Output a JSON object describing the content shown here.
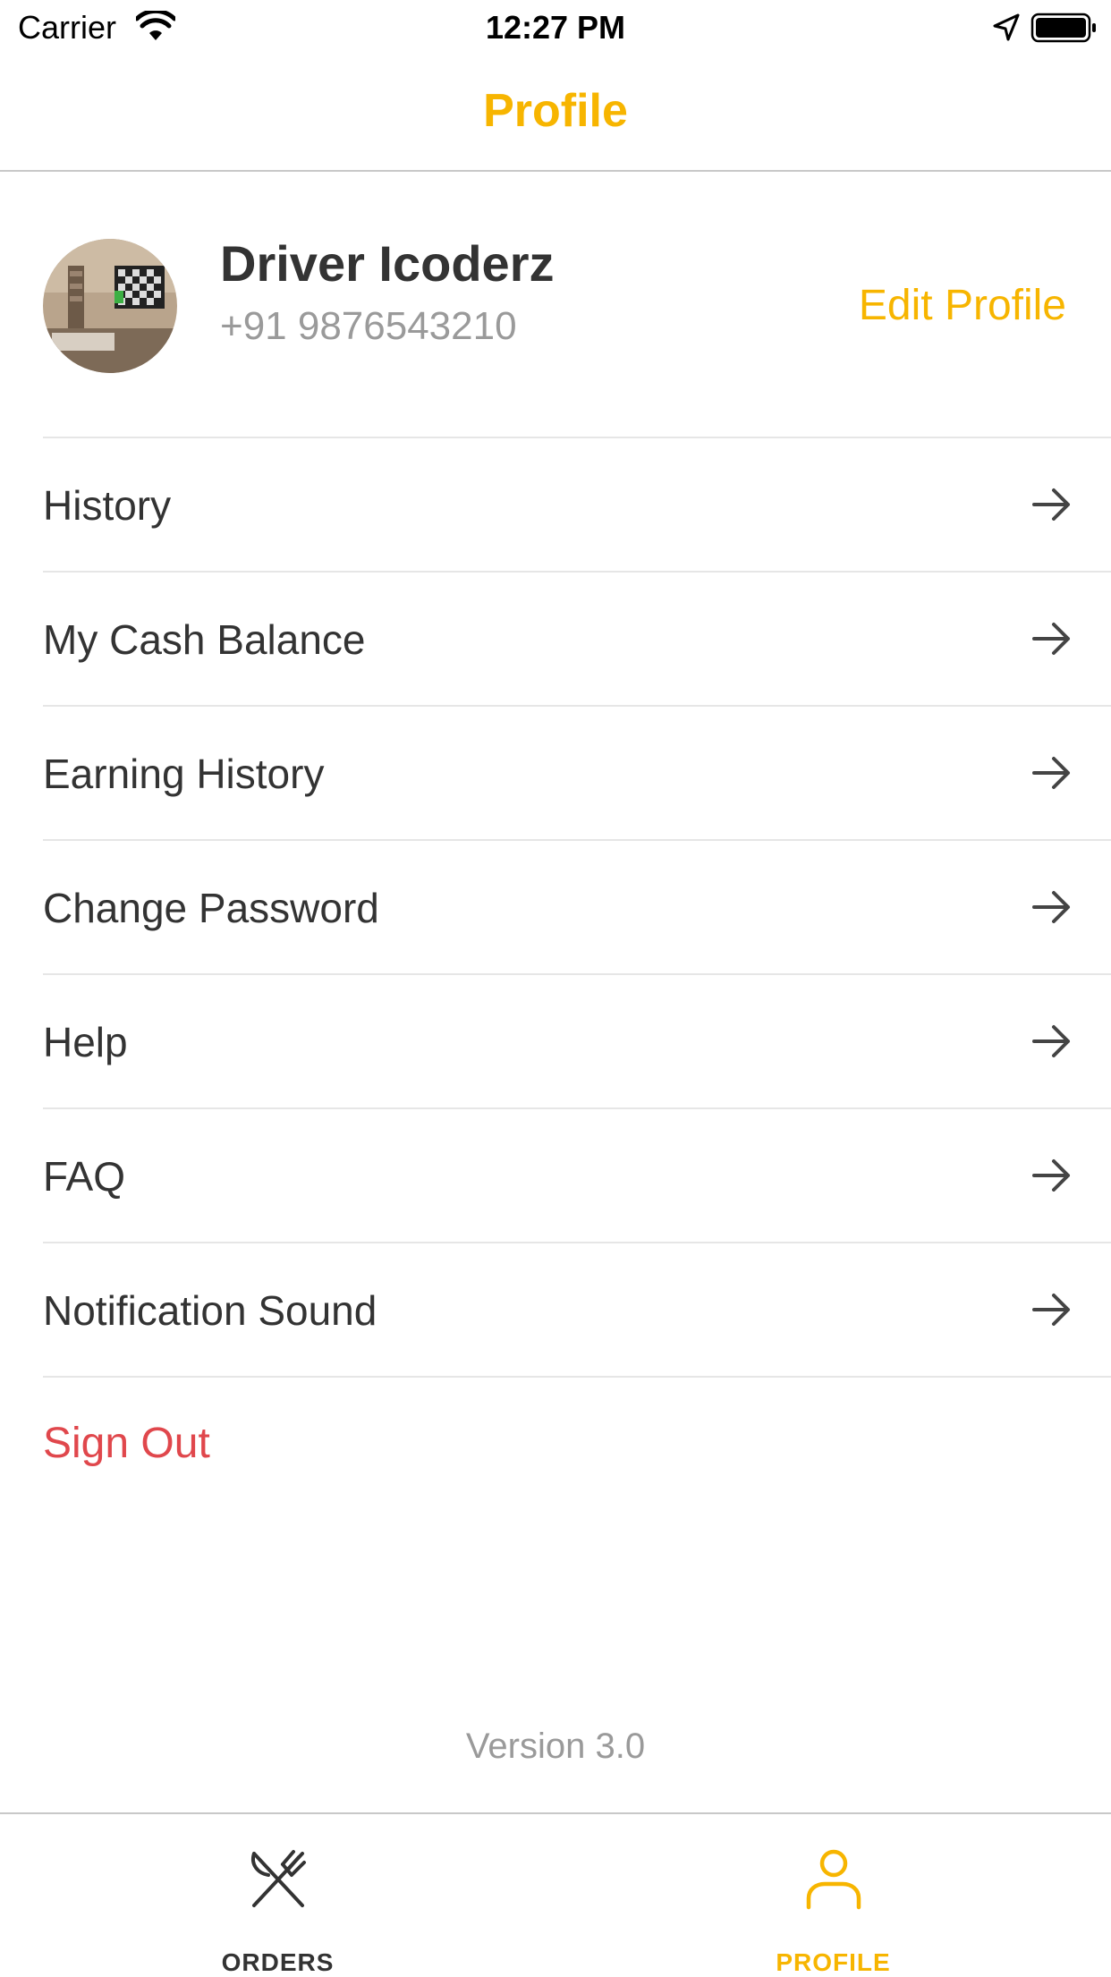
{
  "status_bar": {
    "carrier": "Carrier",
    "time": "12:27 PM"
  },
  "header": {
    "title": "Profile"
  },
  "profile": {
    "name": "Driver Icoderz",
    "phone": "+91 9876543210",
    "edit_label": "Edit Profile"
  },
  "menu": {
    "items": [
      {
        "label": "History"
      },
      {
        "label": "My Cash Balance"
      },
      {
        "label": "Earning History"
      },
      {
        "label": "Change Password"
      },
      {
        "label": "Help"
      },
      {
        "label": "FAQ"
      },
      {
        "label": "Notification Sound"
      }
    ],
    "sign_out_label": "Sign Out"
  },
  "footer": {
    "version": "Version 3.0"
  },
  "tabbar": {
    "tabs": [
      {
        "label": "ORDERS",
        "icon": "fork-knife-icon",
        "active": false
      },
      {
        "label": "PROFILE",
        "icon": "user-icon",
        "active": true
      }
    ]
  },
  "colors": {
    "accent": "#f7b500",
    "danger": "#e0474c",
    "text": "#333333",
    "muted": "#9a9a9a"
  }
}
